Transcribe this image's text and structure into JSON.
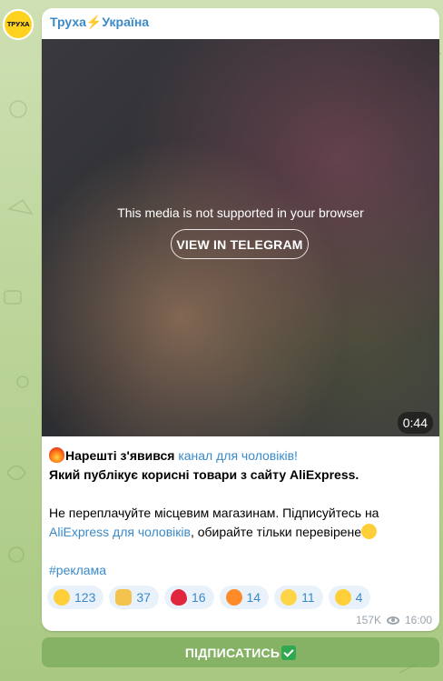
{
  "channel": {
    "avatar_text": "ТРУХА",
    "name_part1": "Труха",
    "bolt": "⚡",
    "name_part2": "Україна"
  },
  "media": {
    "unsupported_text": "This media is not supported in your browser",
    "view_button": "VIEW IN TELEGRAM",
    "duration": "0:44"
  },
  "post": {
    "line1_bold": "Нарешті з'явився",
    "line1_link": "канал для чоловіків!",
    "line2_bold": "Який публікує корисні товари з сайту AliExpress.",
    "line3": "Не переплачуйте місцевим магазинам. Підписуйтесь на",
    "line4_link": "AliExpress для чоловіків",
    "line4_rest": ", обирайте тільки перевірене",
    "hashtag": "#реклама"
  },
  "reactions": [
    {
      "icon": "neutral-face-icon",
      "count": "123"
    },
    {
      "icon": "thumbs-up-icon",
      "count": "37"
    },
    {
      "icon": "red-heart-icon",
      "count": "16"
    },
    {
      "icon": "angry-face-icon",
      "count": "14"
    },
    {
      "icon": "screaming-face-icon",
      "count": "11"
    },
    {
      "icon": "dizzy-face-icon",
      "count": "4"
    }
  ],
  "meta": {
    "views": "157K",
    "time": "16:00"
  },
  "subscribe_button": "ПІДПИСАТИСЬ",
  "colors": {
    "link": "#3a8ac9",
    "background": "#bcd59a",
    "button": "#78aa5a"
  }
}
